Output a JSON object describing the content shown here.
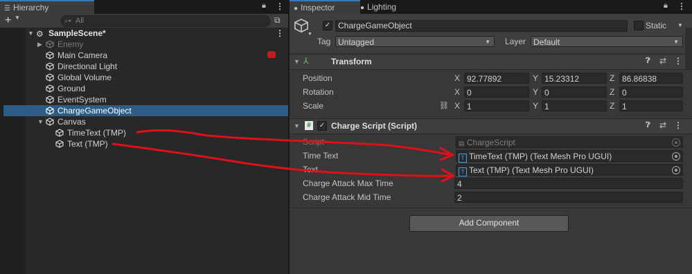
{
  "hierarchy": {
    "tab_label": "Hierarchy",
    "add_label": "+",
    "search_placeholder": "All",
    "scene_name": "SampleScene*",
    "items": [
      {
        "label": "Enemy"
      },
      {
        "label": "Main Camera"
      },
      {
        "label": "Directional Light"
      },
      {
        "label": "Global Volume"
      },
      {
        "label": "Ground"
      },
      {
        "label": "EventSystem"
      },
      {
        "label": "ChargeGameObject"
      },
      {
        "label": "Canvas"
      },
      {
        "label": "TimeText (TMP)"
      },
      {
        "label": "Text (TMP)"
      }
    ]
  },
  "inspector": {
    "tabs": [
      {
        "label": "Inspector"
      },
      {
        "label": "Lighting"
      }
    ],
    "object_name": "ChargeGameObject",
    "static_label": "Static",
    "tag_label": "Tag",
    "tag_value": "Untagged",
    "layer_label": "Layer",
    "layer_value": "Default",
    "transform": {
      "title": "Transform",
      "position_label": "Position",
      "rotation_label": "Rotation",
      "scale_label": "Scale",
      "axis_x": "X",
      "axis_y": "Y",
      "axis_z": "Z",
      "position": {
        "x": "92.77892",
        "y": "15.23312",
        "z": "86.86838"
      },
      "rotation": {
        "x": "0",
        "y": "0",
        "z": "0"
      },
      "scale": {
        "x": "1",
        "y": "1",
        "z": "1"
      }
    },
    "charge_script": {
      "title": "Charge Script (Script)",
      "script_label": "Script",
      "script_value": "ChargeScript",
      "time_text_label": "Time Text",
      "time_text_value": "TimeText (TMP) (Text Mesh Pro UGUI)",
      "text_label": "Text",
      "text_value": "Text (TMP) (Text Mesh Pro UGUI)",
      "max_time_label": "Charge Attack Max Time",
      "max_time_value": "4",
      "mid_time_label": "Charge Attack Mid Time",
      "mid_time_value": "2"
    },
    "add_component_label": "Add Component"
  },
  "colors": {
    "selection": "#2c5d87",
    "annotation": "#e0101a",
    "panel": "#383838"
  }
}
